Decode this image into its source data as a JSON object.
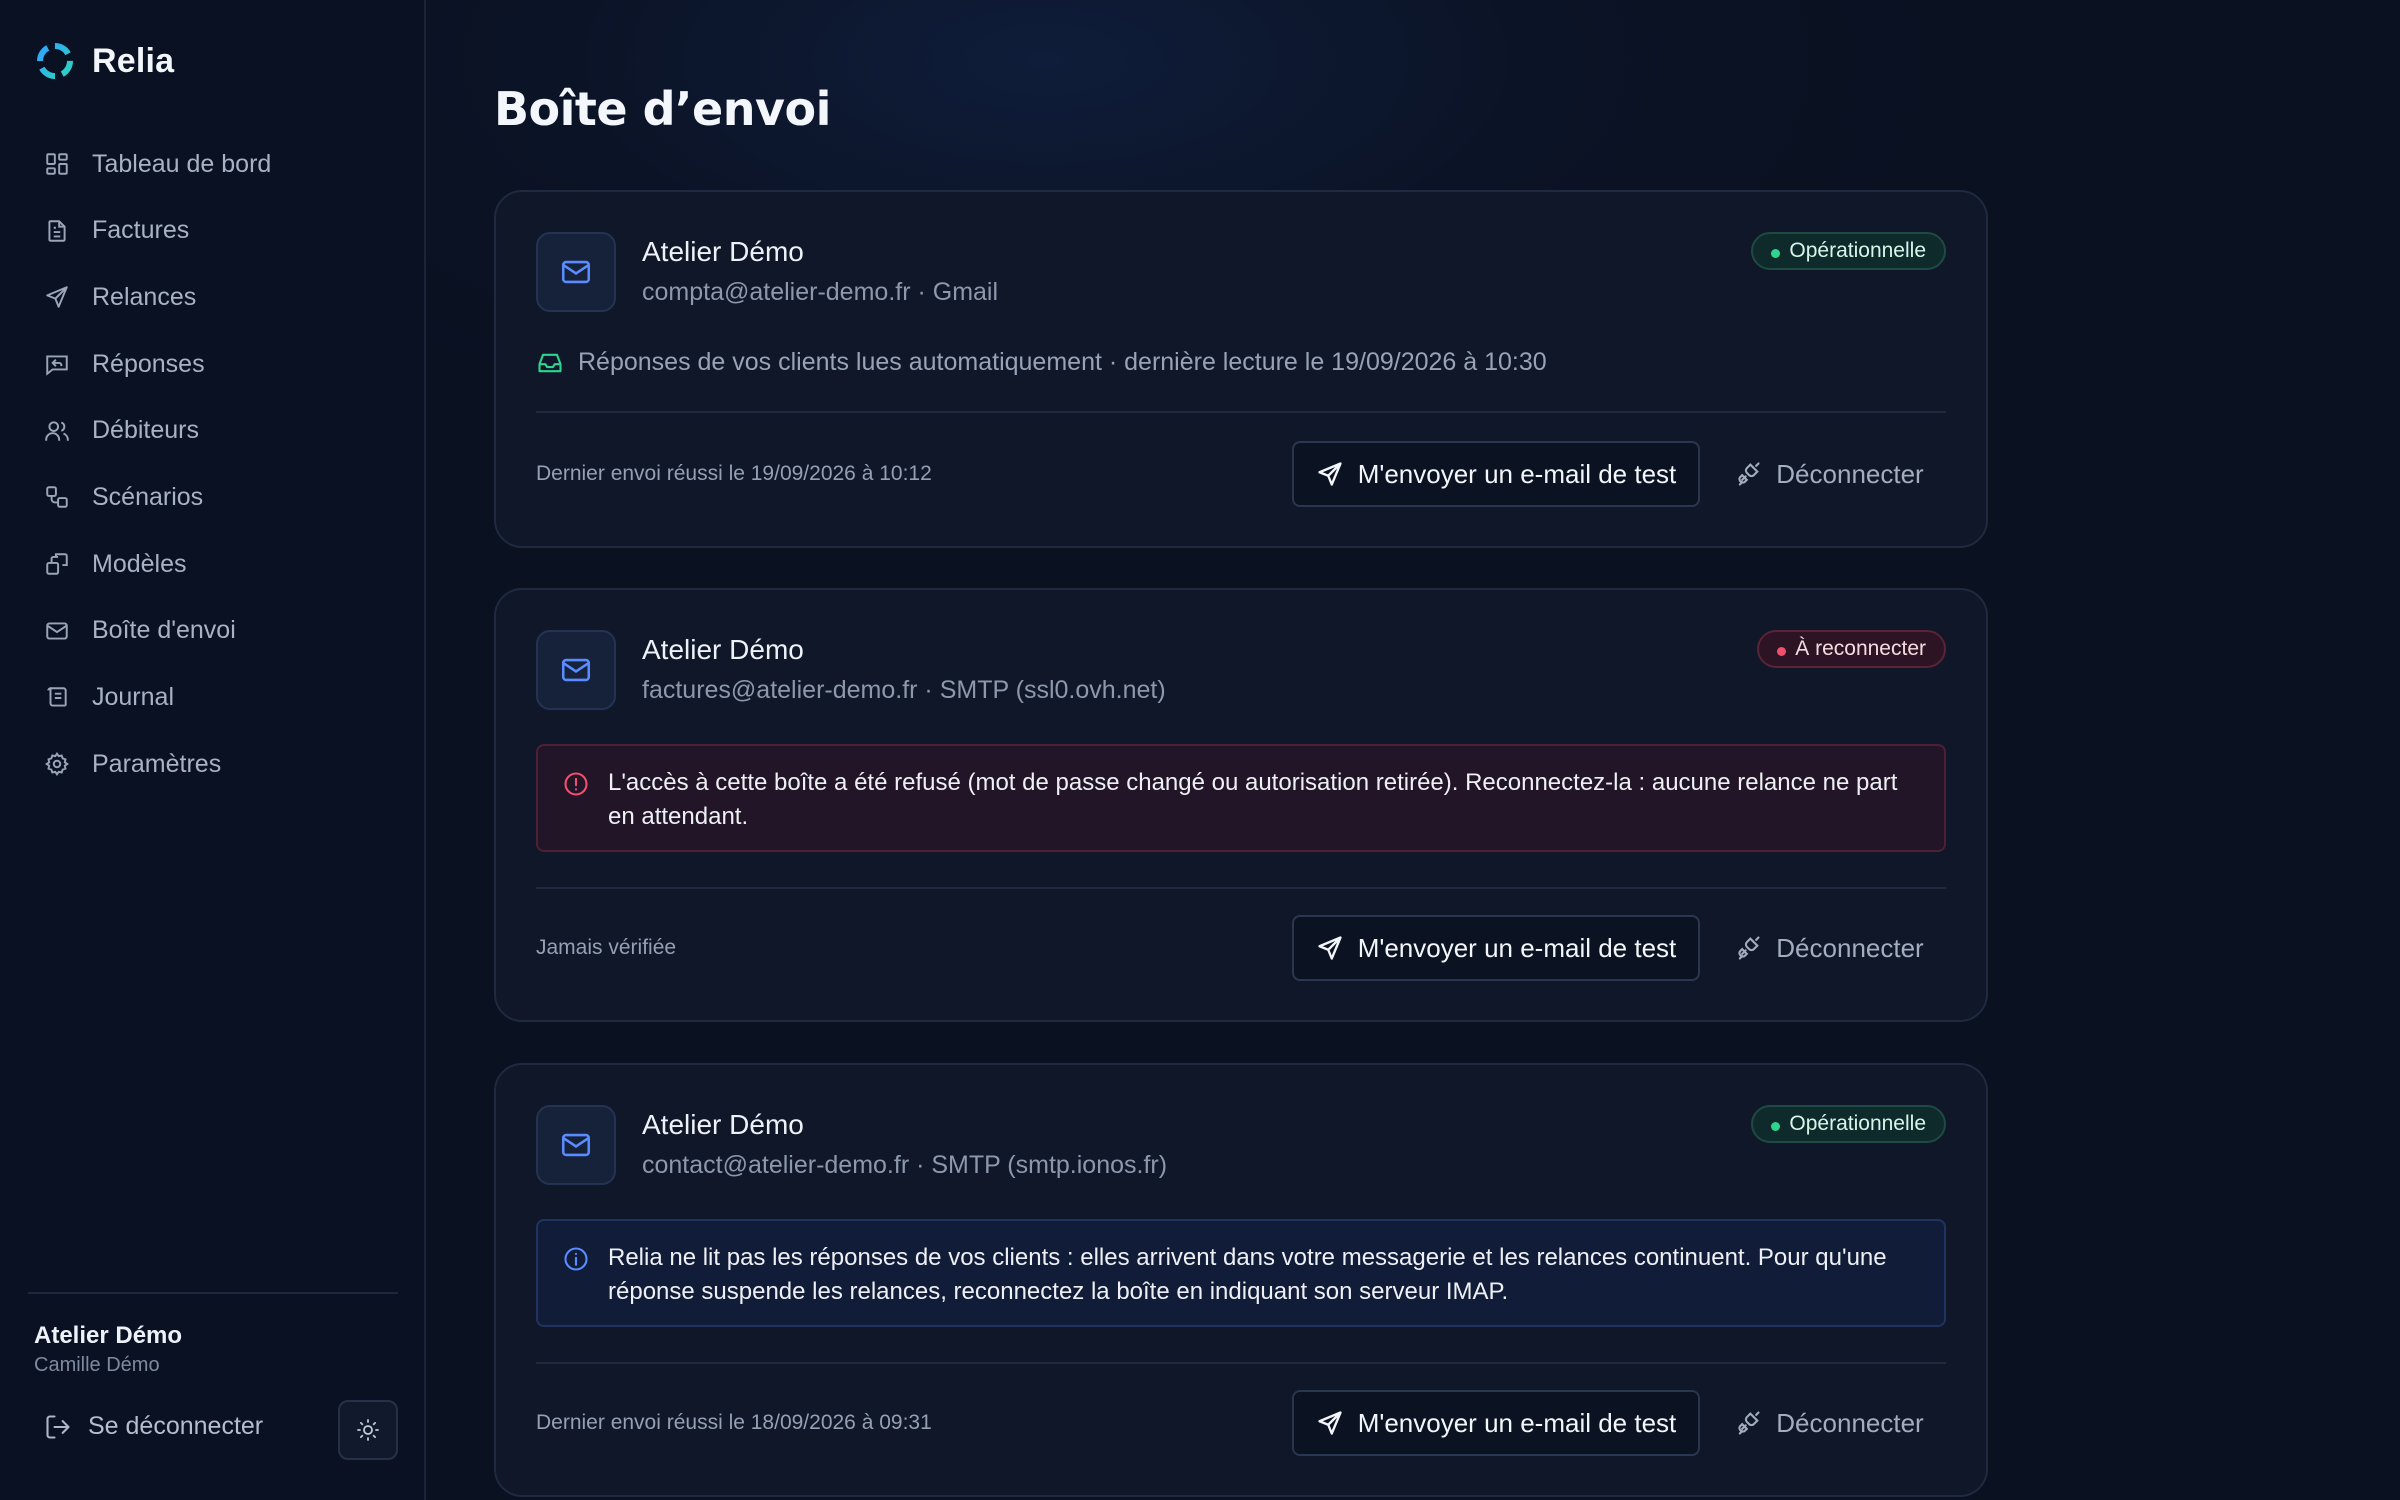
{
  "brand": {
    "name": "Relia"
  },
  "colors": {
    "accent": "#5b8cff",
    "success": "#2fd58f",
    "danger": "#f0506e",
    "background": "#0b1222"
  },
  "sidebar": {
    "items": [
      {
        "label": "Tableau de bord",
        "icon": "dashboard-icon"
      },
      {
        "label": "Factures",
        "icon": "invoice-icon"
      },
      {
        "label": "Relances",
        "icon": "send-icon"
      },
      {
        "label": "Réponses",
        "icon": "reply-icon"
      },
      {
        "label": "Débiteurs",
        "icon": "users-icon"
      },
      {
        "label": "Scénarios",
        "icon": "workflow-icon"
      },
      {
        "label": "Modèles",
        "icon": "templates-icon"
      },
      {
        "label": "Boîte d'envoi",
        "icon": "mail-icon"
      },
      {
        "label": "Journal",
        "icon": "log-icon"
      },
      {
        "label": "Paramètres",
        "icon": "gear-icon"
      }
    ],
    "account": {
      "name": "Atelier Démo",
      "user": "Camille Démo"
    },
    "logout_label": "Se déconnecter"
  },
  "main": {
    "title": "Boîte d’envoi",
    "test_button_label": "M'envoyer un e-mail de test",
    "disconnect_label": "Déconnecter",
    "cards": [
      {
        "title": "Atelier Démo",
        "subtitle": "compta@atelier-demo.fr · Gmail",
        "status": "Opérationnelle",
        "info": "Réponses de vos clients lues automatiquement · dernière lecture le 19/09/2026 à 10:30",
        "footer": "Dernier envoi réussi le 19/09/2026 à 10:12"
      },
      {
        "title": "Atelier Démo",
        "subtitle": "factures@atelier-demo.fr · SMTP (ssl0.ovh.net)",
        "status": "À reconnecter",
        "alert": "L'accès à cette boîte a été refusé (mot de passe changé ou autorisation retirée). Reconnectez-la : aucune relance ne part en attendant.",
        "footer": "Jamais vérifiée"
      },
      {
        "title": "Atelier Démo",
        "subtitle": "contact@atelier-demo.fr · SMTP (smtp.ionos.fr)",
        "status": "Opérationnelle",
        "alert": "Relia ne lit pas les réponses de vos clients : elles arrivent dans votre messagerie et les relances continuent. Pour qu'une réponse suspende les relances, reconnectez la boîte en indiquant son serveur IMAP.",
        "footer": "Dernier envoi réussi le 18/09/2026 à 09:31"
      }
    ]
  }
}
